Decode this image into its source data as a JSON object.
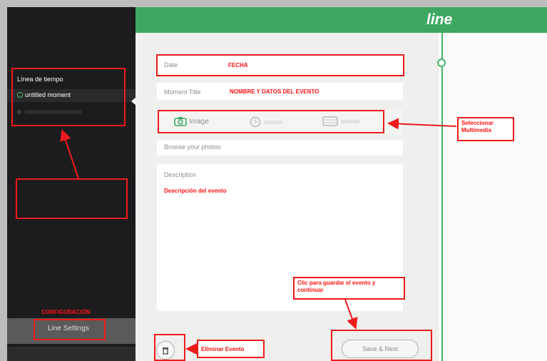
{
  "app": {
    "logo": "line"
  },
  "sidebar": {
    "brand": "",
    "items": [
      {
        "label": "Línea de tiempo"
      },
      {
        "label": "untitled moment"
      }
    ],
    "settings_label": "Line Settings"
  },
  "form": {
    "date_label": "Date",
    "title_label": "Moment Title",
    "media_tabs": [
      {
        "label": "Image",
        "icon": "camera-icon"
      },
      {
        "label": "",
        "icon": "clock-icon"
      },
      {
        "label": "",
        "icon": "film-icon"
      }
    ],
    "browse_label": "Browse your photos",
    "description_label": "Description",
    "save_label": "Save & Next",
    "delete_icon": "trash-icon"
  },
  "annotations": {
    "fecha": "FECHA",
    "nombre": "NOMBRE Y DATOS DEL EVENTO",
    "descripcion": "Descripción del evento",
    "seleccionar": "Seleccionar Multimedia",
    "guardar": "Clic para guardar el evento y continuar",
    "eliminar": "Eliminar Evento",
    "configuracion": "CONFIGURACIÓN",
    "sidebar_note": ""
  },
  "colors": {
    "accent": "#3ea862",
    "annotation": "#ee1b1b",
    "sidebar": "#1c1c1e"
  }
}
